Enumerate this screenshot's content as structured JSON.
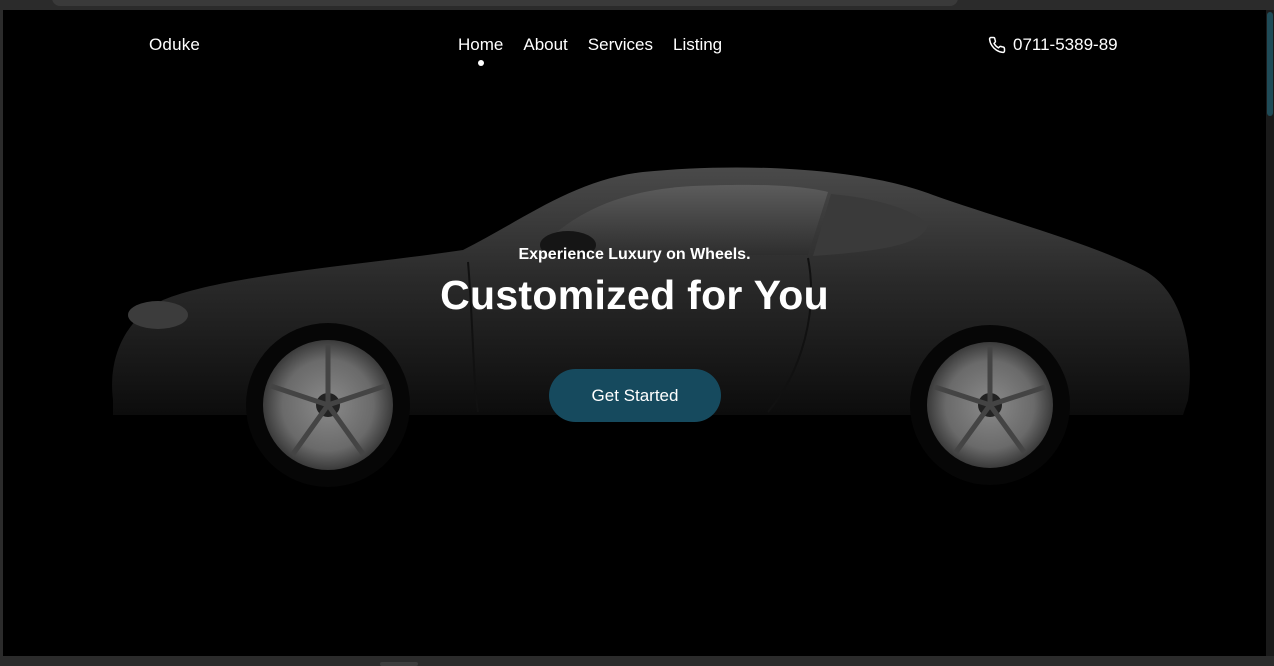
{
  "navbar": {
    "brand": "Oduke",
    "links": [
      "Home",
      "About",
      "Services",
      "Listing"
    ],
    "active_link": "Home",
    "phone_icon": "phone-icon",
    "phone": "0711-5389-89"
  },
  "hero": {
    "subtitle": "Experience Luxury on Wheels.",
    "title": "Customized for You",
    "cta_label": "Get Started",
    "image": "black-sports-car"
  },
  "colors": {
    "background": "#000000",
    "text": "#ffffff",
    "cta": "#164a5e",
    "scrollbar_thumb": "#1f4b57"
  }
}
